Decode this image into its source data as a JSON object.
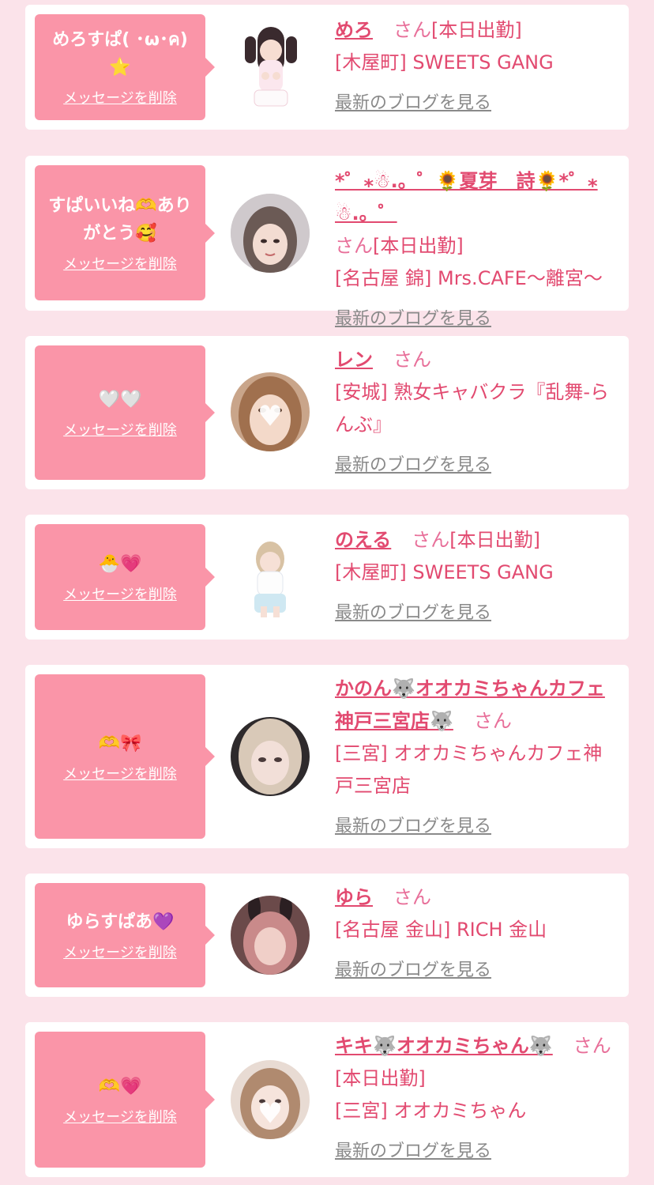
{
  "delete_label": "メッセージを削除",
  "san_label": "さん",
  "blog_label": "最新のブログを見る",
  "colors": {
    "bubble": "#fa95a8",
    "accent": "#e24a70",
    "background": "#fbe3ea",
    "link_gray": "#8a8a8a"
  },
  "messages": [
    {
      "message": "めろすぱ( ･ω･ค)⭐",
      "name": "めろ",
      "status": "[本日出勤]",
      "shop": "[木屋町] SWEETS GANG"
    },
    {
      "message": "すぱいいね🫶ありがとう🥰",
      "name": "*゜⁎☃.。゜🌻夏芽　詩🌻*゜⁎☃.。゜",
      "status": "[本日出勤]",
      "shop": "[名古屋 錦] Mrs.CAFE〜離宮〜"
    },
    {
      "message": "🤍🤍",
      "name": "レン",
      "status": "",
      "shop": "[安城] 熟女キャバクラ『乱舞-らんぶ』"
    },
    {
      "message": "🐣💗",
      "name": "のえる",
      "status": "[本日出勤]",
      "shop": "[木屋町] SWEETS GANG"
    },
    {
      "message": "🫶🎀",
      "name": "かのん🐺オオカミちゃんカフェ神戸三宮店🐺",
      "status": "",
      "shop": "[三宮] オオカミちゃんカフェ神戸三宮店"
    },
    {
      "message": "ゆらすぱあ💜",
      "name": "ゆら",
      "status": "",
      "shop": "[名古屋 金山] RICH 金山"
    },
    {
      "message": "🫶💗",
      "name": "キキ🐺オオカミちゃん🐺",
      "status": "[本日出勤]",
      "shop": "[三宮] オオカミちゃん"
    }
  ]
}
